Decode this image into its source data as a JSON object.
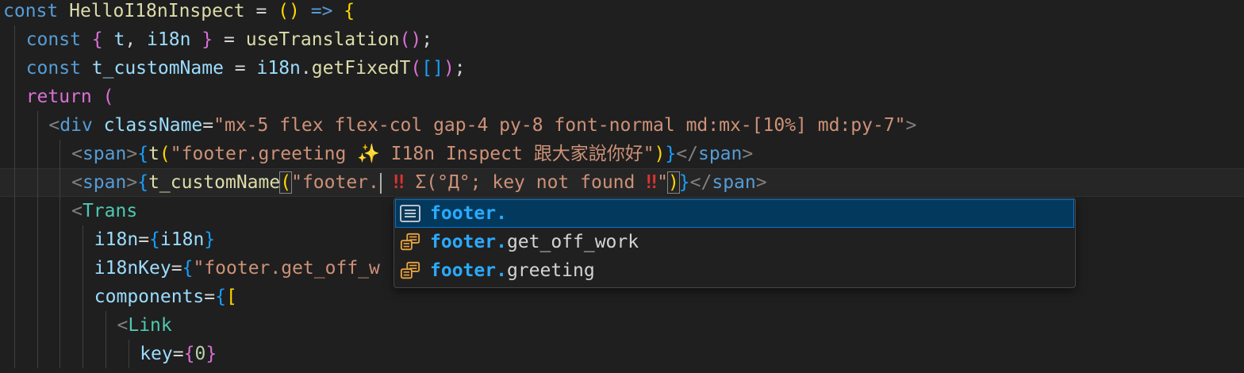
{
  "editor": {
    "lines": [
      {
        "indent": 0,
        "segments": [
          {
            "t": "const ",
            "c": "kw"
          },
          {
            "t": "HelloI18nInspect",
            "c": "fn"
          },
          {
            "t": " = ",
            "c": "plain"
          },
          {
            "t": "()",
            "c": "br1"
          },
          {
            "t": " => ",
            "c": "kw"
          },
          {
            "t": "{",
            "c": "br1"
          }
        ]
      },
      {
        "indent": 1,
        "segments": [
          {
            "t": "const ",
            "c": "kw"
          },
          {
            "t": "{ ",
            "c": "br2"
          },
          {
            "t": "t",
            "c": "var"
          },
          {
            "t": ", ",
            "c": "plain"
          },
          {
            "t": "i18n",
            "c": "var"
          },
          {
            "t": " }",
            "c": "br2"
          },
          {
            "t": " = ",
            "c": "plain"
          },
          {
            "t": "useTranslation",
            "c": "fn"
          },
          {
            "t": "()",
            "c": "br2"
          },
          {
            "t": ";",
            "c": "plain"
          }
        ]
      },
      {
        "indent": 1,
        "segments": [
          {
            "t": "const ",
            "c": "kw"
          },
          {
            "t": "t_customName",
            "c": "var"
          },
          {
            "t": " = ",
            "c": "plain"
          },
          {
            "t": "i18n",
            "c": "var"
          },
          {
            "t": ".",
            "c": "plain"
          },
          {
            "t": "getFixedT",
            "c": "fn"
          },
          {
            "t": "(",
            "c": "br2"
          },
          {
            "t": "[]",
            "c": "br3"
          },
          {
            "t": ")",
            "c": "br2"
          },
          {
            "t": ";",
            "c": "plain"
          }
        ]
      },
      {
        "indent": 1,
        "segments": [
          {
            "t": "return ",
            "c": "br2"
          },
          {
            "t": "(",
            "c": "br2"
          }
        ]
      },
      {
        "indent": 2,
        "segments": [
          {
            "t": "<",
            "c": "punc"
          },
          {
            "t": "div",
            "c": "ptag"
          },
          {
            "t": " className",
            "c": "var"
          },
          {
            "t": "=",
            "c": "plain"
          },
          {
            "t": "\"mx-5 flex flex-col gap-4 py-8 font-normal md:mx-[10%] md:py-7\"",
            "c": "str"
          },
          {
            "t": ">",
            "c": "punc"
          }
        ]
      },
      {
        "indent": 3,
        "segments": [
          {
            "t": "<",
            "c": "punc"
          },
          {
            "t": "span",
            "c": "ptag"
          },
          {
            "t": ">",
            "c": "punc"
          },
          {
            "t": "{",
            "c": "br3"
          },
          {
            "t": "t",
            "c": "fn"
          },
          {
            "t": "(",
            "c": "br1"
          },
          {
            "t": "\"footer.greeting ",
            "c": "str"
          },
          {
            "t": "✨",
            "c": "sparkle"
          },
          {
            "t": " I18n Inspect 跟大家說你好\"",
            "c": "str"
          },
          {
            "t": ")",
            "c": "br1"
          },
          {
            "t": "}",
            "c": "br3"
          },
          {
            "t": "</",
            "c": "punc"
          },
          {
            "t": "span",
            "c": "ptag"
          },
          {
            "t": ">",
            "c": "punc"
          }
        ]
      },
      {
        "indent": 3,
        "current": true,
        "segments": [
          {
            "t": "<",
            "c": "punc"
          },
          {
            "t": "span",
            "c": "ptag"
          },
          {
            "t": ">",
            "c": "punc"
          },
          {
            "t": "{",
            "c": "br3"
          },
          {
            "t": "t_customName",
            "c": "fn"
          },
          {
            "t": "(",
            "c": "br1 bracket-match"
          },
          {
            "t": "\"footer.",
            "c": "str"
          },
          {
            "cursor": true
          },
          {
            "t": " ‼ ",
            "c": "emoji-red"
          },
          {
            "t": "Σ(°Д°; key not found ",
            "c": "str"
          },
          {
            "t": "‼",
            "c": "emoji-red"
          },
          {
            "t": "\"",
            "c": "str"
          },
          {
            "t": ")",
            "c": "br1 bracket-match"
          },
          {
            "t": "}",
            "c": "br3"
          },
          {
            "t": "</",
            "c": "punc"
          },
          {
            "t": "span",
            "c": "ptag"
          },
          {
            "t": ">",
            "c": "punc"
          }
        ]
      },
      {
        "indent": 3,
        "segments": [
          {
            "t": "<",
            "c": "punc"
          },
          {
            "t": "Trans",
            "c": "tag"
          }
        ]
      },
      {
        "indent": 4,
        "segments": [
          {
            "t": "i18n",
            "c": "var"
          },
          {
            "t": "=",
            "c": "plain"
          },
          {
            "t": "{",
            "c": "br3"
          },
          {
            "t": "i18n",
            "c": "var"
          },
          {
            "t": "}",
            "c": "br3"
          }
        ]
      },
      {
        "indent": 4,
        "segments": [
          {
            "t": "i18nKey",
            "c": "var"
          },
          {
            "t": "=",
            "c": "plain"
          },
          {
            "t": "{",
            "c": "br3"
          },
          {
            "t": "\"footer.get_off_w",
            "c": "str"
          }
        ]
      },
      {
        "indent": 4,
        "segments": [
          {
            "t": "components",
            "c": "var"
          },
          {
            "t": "=",
            "c": "plain"
          },
          {
            "t": "{",
            "c": "br3"
          },
          {
            "t": "[",
            "c": "br1"
          }
        ]
      },
      {
        "indent": 5,
        "segments": [
          {
            "t": "<",
            "c": "punc"
          },
          {
            "t": "Link",
            "c": "tag"
          }
        ]
      },
      {
        "indent": 6,
        "segments": [
          {
            "t": "key",
            "c": "var"
          },
          {
            "t": "=",
            "c": "plain"
          },
          {
            "t": "{",
            "c": "br2"
          },
          {
            "t": "0",
            "c": "num"
          },
          {
            "t": "}",
            "c": "br2"
          }
        ]
      }
    ]
  },
  "suggest": {
    "items": [
      {
        "icon": "text-icon",
        "match": "footer.",
        "rest": "",
        "selected": true
      },
      {
        "icon": "reference-icon",
        "match": "footer.",
        "rest": "get_off_work",
        "selected": false
      },
      {
        "icon": "reference-icon",
        "match": "footer.",
        "rest": "greeting",
        "selected": false
      }
    ]
  }
}
